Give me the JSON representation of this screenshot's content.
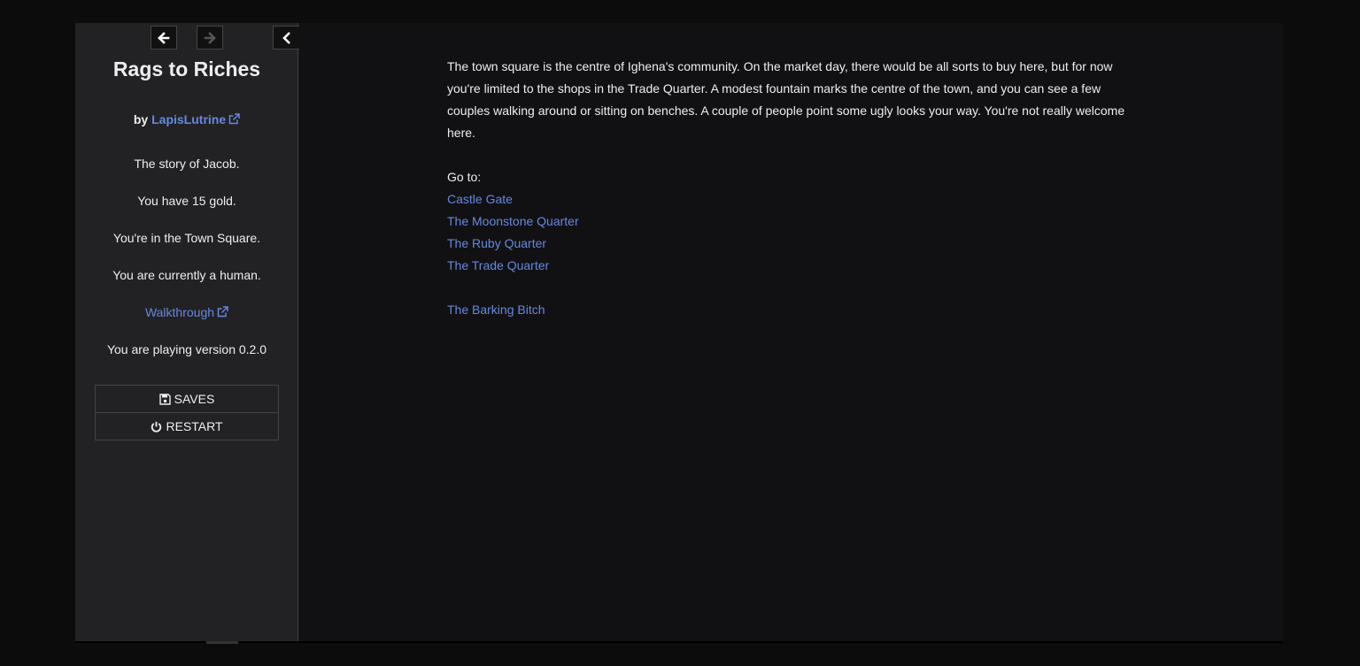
{
  "sidebar": {
    "title": "Rags to Riches",
    "by_prefix": "by ",
    "author": "LapisLutrine",
    "story_line": "The story of Jacob.",
    "gold_line": "You have 15 gold.",
    "location_line": "You're in the Town Square.",
    "form_line": "You are currently a human.",
    "walkthrough_label": "Walkthrough",
    "version_line": "You are playing version 0.2.0",
    "menu": {
      "saves_label": "SAVES",
      "restart_label": "RESTART"
    }
  },
  "passage": {
    "description": "The town square is the centre of Ighena's community. On the market day, there would be all sorts to buy here, but for now you're limited to the shops in the Trade Quarter. A modest fountain marks the centre of the town, and you can see a few couples walking around or sitting on benches. A couple of people point some ugly looks your way. You're not really welcome here.",
    "goto_label": "Go to:",
    "destinations": [
      "Castle Gate",
      "The Moonstone Quarter",
      "The Ruby Quarter",
      "The Trade Quarter"
    ],
    "tavern_link": "The Barking Bitch"
  },
  "colors": {
    "background": "#0c0c0c",
    "passage_bg": "#111114",
    "sidebar_bg": "#222225",
    "text": "#eeeeee",
    "link": "#6688dd"
  }
}
